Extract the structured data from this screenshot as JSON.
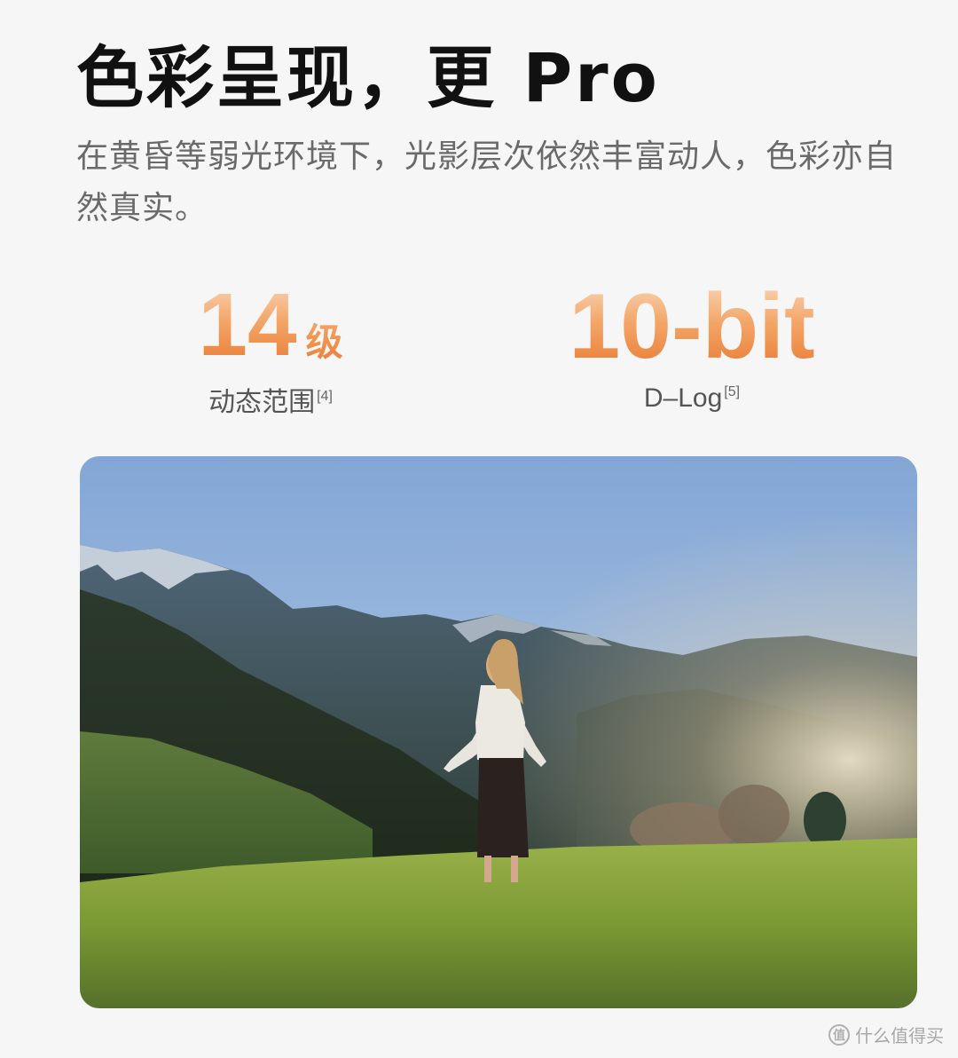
{
  "header": {
    "title": "色彩呈现，更 Pro",
    "subtitle": "在黄昏等弱光环境下，光影层次依然丰富动人，色彩亦自然真实。"
  },
  "stats": [
    {
      "value": "14",
      "unit": "级",
      "label": "动态范围",
      "note": "[4]"
    },
    {
      "value": "10-bit",
      "unit": "",
      "label": "D–Log",
      "note": "[5]"
    }
  ],
  "watermark": {
    "logo": "值",
    "text": "什么值得买"
  },
  "colors": {
    "stat_gradient_top": "#f8d7b8",
    "stat_gradient_bottom": "#e97a33",
    "title": "#111111",
    "subtitle": "#6a6a6a"
  }
}
